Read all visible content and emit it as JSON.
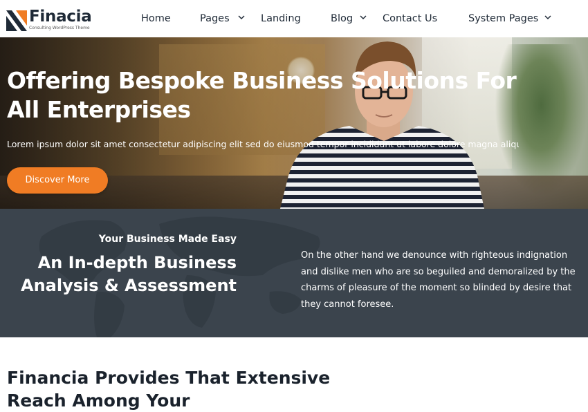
{
  "brand": {
    "name": "Finacia",
    "tagline": "Consulting WordPress Theme",
    "colors": {
      "accent": "#f07c24",
      "dark": "#1f2a37",
      "band": "#3b444d"
    }
  },
  "nav": {
    "items": [
      {
        "label": "Home",
        "has_dropdown": false
      },
      {
        "label": "Pages",
        "has_dropdown": true
      },
      {
        "label": "Landing",
        "has_dropdown": false
      },
      {
        "label": "Blog",
        "has_dropdown": true
      },
      {
        "label": "Contact Us",
        "has_dropdown": false
      },
      {
        "label": "System Pages",
        "has_dropdown": true
      }
    ],
    "dropdown_icon": "chevron-down-icon"
  },
  "hero": {
    "title": "Offering Bespoke Business Solutions For All Enterprises",
    "text": "Lorem ipsum dolor sit amet consectetur adipiscing elit sed do eiusmod tempor incididunt ut labore dolore magna aliqua...",
    "button_label": "Discover More"
  },
  "about": {
    "kicker": "Your Business Made Easy",
    "title": "An In-depth Business Analysis & Assessment",
    "text": "On the other hand we denounce with righteous indignation and dislike men who are so beguiled and demoralized by the charms of pleasure of the moment so blinded by desire that they cannot foresee."
  },
  "section": {
    "title": "Financia Provides That Extensive Reach Among Your"
  }
}
